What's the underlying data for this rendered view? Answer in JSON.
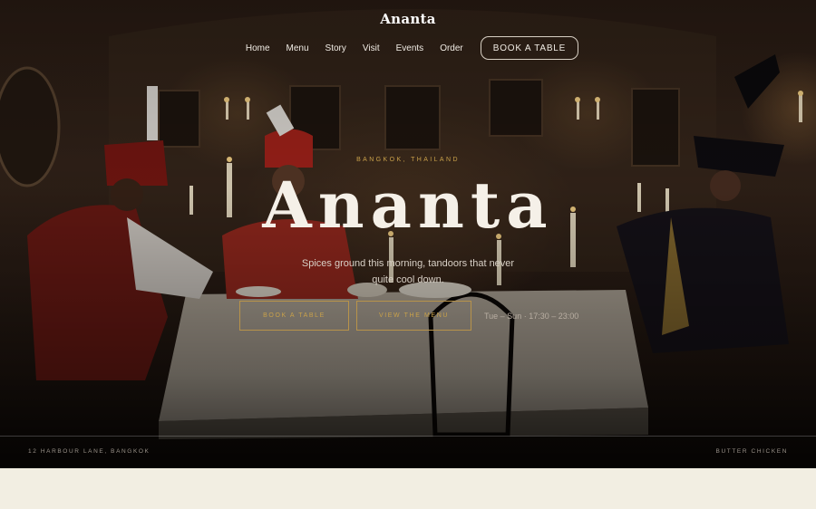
{
  "brand": {
    "name": "Ananta"
  },
  "nav": {
    "links": [
      "Home",
      "Menu",
      "Story",
      "Visit",
      "Events",
      "Order"
    ],
    "book_label": "BOOK A TABLE"
  },
  "hero": {
    "kicker": "BANGKOK, THAILAND",
    "title": "Ananta",
    "tagline": "Spices ground this morning, tandoors that never quite cool down.",
    "cta_primary": "BOOK A TABLE",
    "cta_secondary": "VIEW THE MENU",
    "hours": "Tue – Sun · 17:30 – 23:00"
  },
  "footer_bar": {
    "address": "12 HARBOUR LANE, BANGKOK",
    "feature": "BUTTER CHICKEN"
  },
  "colors": {
    "accent_gold": "#c9a14a",
    "cream": "#f2eee2",
    "text_light": "#f5f0e8"
  }
}
